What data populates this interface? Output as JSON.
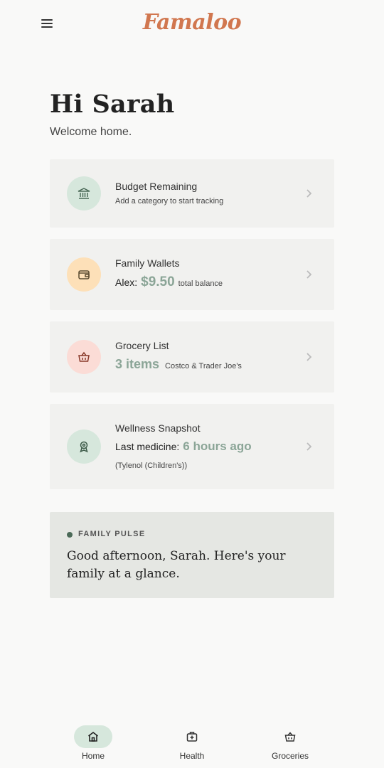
{
  "app": {
    "logo": "Famaloo"
  },
  "greeting": {
    "title": "Hi Sarah",
    "subtitle": "Welcome home."
  },
  "cards": {
    "budget": {
      "title": "Budget Remaining",
      "subtitle": "Add a category to start tracking",
      "icon": "bank-icon",
      "icon_bg": "#d6e7dc"
    },
    "wallets": {
      "title": "Family Wallets",
      "member": "Alex:",
      "amount": "$9.50",
      "amount_note": "total balance",
      "icon": "wallet-icon",
      "icon_bg": "#fde0b8"
    },
    "grocery": {
      "title": "Grocery List",
      "count": "3 items",
      "stores": "Costco & Trader Joe's",
      "icon": "basket-icon",
      "icon_bg": "#fbdcd6"
    },
    "wellness": {
      "title": "Wellness Snapshot",
      "label": "Last medicine:",
      "time": "6 hours ago",
      "detail": "(Tylenol (Children's))",
      "icon": "medal-icon",
      "icon_bg": "#d6e7dc"
    }
  },
  "pulse": {
    "label": "FAMILY PULSE",
    "message": "Good afternoon, Sarah. Here's your family at a glance."
  },
  "nav": {
    "items": [
      {
        "label": "Home",
        "icon": "home-icon",
        "active": true
      },
      {
        "label": "Health",
        "icon": "medical-bag-icon",
        "active": false
      },
      {
        "label": "Groceries",
        "icon": "basket-icon",
        "active": false
      }
    ]
  },
  "colors": {
    "accent": "#8ba597",
    "brand": "#d1774f",
    "card_bg": "#f1f1ef",
    "pulse_bg": "#e5e7e3",
    "nav_active": "#d6e7dc"
  }
}
